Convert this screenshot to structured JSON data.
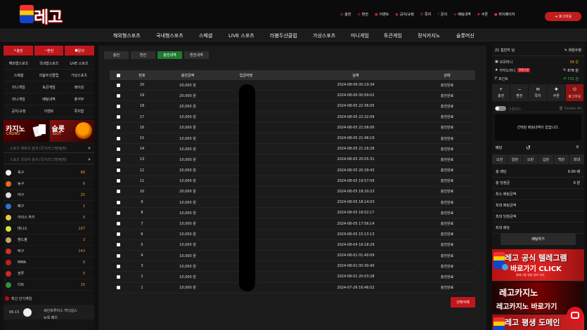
{
  "header": {
    "logo_text": "레고",
    "top_menu": [
      {
        "icon": "plus-icon",
        "label": "충전"
      },
      {
        "icon": "minus-icon",
        "label": "환전"
      },
      {
        "icon": "gift-icon",
        "label": "이벤트"
      },
      {
        "icon": "notice-icon",
        "label": "공지/규정"
      },
      {
        "icon": "mail-icon",
        "label": "쪽지"
      },
      {
        "icon": "question-icon",
        "label": "문의"
      },
      {
        "icon": "list-icon",
        "label": "배팅내역"
      },
      {
        "icon": "point-icon",
        "label": "쿠폰"
      },
      {
        "icon": "user-icon",
        "label": "마이페이지"
      }
    ],
    "logout_label": "로그아웃"
  },
  "nav": [
    "해외형스포츠",
    "국내형스포츠",
    "스페셜",
    "LIVE 스포츠",
    "라붐두샨클럽",
    "가상스포츠",
    "미니게임",
    "토큰게임",
    "정식카지노",
    "슬롯머신"
  ],
  "left": {
    "buttons": [
      "충전",
      "환전",
      "문의"
    ],
    "grid": [
      "해외형스포츠",
      "국내형스포츠",
      "LIVE 스포츠",
      "스페셜",
      "라붐두샨클럽",
      "가상스포츠",
      "미니게임",
      "토큰게임",
      "레이싱",
      "미니게임",
      "배팅내역",
      "출석부",
      "공지/규정",
      "이벤트",
      "쪽지함"
    ],
    "banner1_title": "카지노",
    "banner1_sub": "CASINO",
    "banner2_title": "슬롯",
    "banner2_sub": "SLOT",
    "search1_placeholder": "스포츠 해외식 검색 (국가/리그명/팀명)",
    "search2_placeholder": "스포츠 국내식 검색 (국가/리그명/팀명)",
    "sports": [
      {
        "name": "축구",
        "count": "88",
        "color": "#f2f2f2"
      },
      {
        "name": "농구",
        "count": "6",
        "color": "#e76b1a"
      },
      {
        "name": "야구",
        "count": "25",
        "color": "#dcdcdc"
      },
      {
        "name": "배구",
        "count": "1",
        "color": "#2f6fd6"
      },
      {
        "name": "아이스 하키",
        "count": "0",
        "color": "#e8c547"
      },
      {
        "name": "테니스",
        "count": "107",
        "color": "#d7e23a"
      },
      {
        "name": "핸드볼",
        "count": "3",
        "color": "#c8a56a"
      },
      {
        "name": "탁구",
        "count": "143",
        "color": "#d23030"
      },
      {
        "name": "MMA",
        "count": "0",
        "color": "#c02020"
      },
      {
        "name": "권투",
        "count": "0",
        "color": "#d02828"
      },
      {
        "name": "다트",
        "count": "15",
        "color": "#3a8f3a"
      }
    ],
    "popular_label": "최신 인기게임",
    "match": {
      "time": "06:15",
      "team1": "세인트루이스 카디널스",
      "team2": "뉴욕 메츠"
    }
  },
  "center": {
    "tabs": [
      "충전",
      "환전",
      "충전내역",
      "환전내역"
    ],
    "active_tab": 2,
    "headers": [
      "번호",
      "충전금액",
      "입금자명",
      "날짜",
      "상태"
    ],
    "rows": [
      {
        "no": "20",
        "amount": "20,000 원",
        "date": "2024-08-06 00:19:34",
        "status": "충전완료"
      },
      {
        "no": "19",
        "amount": "20,000 원",
        "date": "2024-08-06 00:09:02",
        "status": "충전완료"
      },
      {
        "no": "18",
        "amount": "20,000 원",
        "date": "2024-08-05 22:36:05",
        "status": "충전완료"
      },
      {
        "no": "17",
        "amount": "10,000 원",
        "date": "2024-08-05 22:32:09",
        "status": "충전완료"
      },
      {
        "no": "16",
        "amount": "10,000 원",
        "date": "2024-08-05 21:58:06",
        "status": "충전완료"
      },
      {
        "no": "15",
        "amount": "10,000 원",
        "date": "2024-08-05 21:46:19",
        "status": "충전완료"
      },
      {
        "no": "14",
        "amount": "10,000 원",
        "date": "2024-08-05 21:16:28",
        "status": "충전완료"
      },
      {
        "no": "13",
        "amount": "10,000 원",
        "date": "2024-08-05 20:55:31",
        "status": "충전완료"
      },
      {
        "no": "12",
        "amount": "20,000 원",
        "date": "2024-08-05 20:39:43",
        "status": "충전완료"
      },
      {
        "no": "11",
        "amount": "10,000 원",
        "date": "2024-08-05 19:57:59",
        "status": "충전완료"
      },
      {
        "no": "10",
        "amount": "20,000 원",
        "date": "2024-08-05 18:20:23",
        "status": "충전완료"
      },
      {
        "no": "9",
        "amount": "10,000 원",
        "date": "2024-08-05 18:14:03",
        "status": "충전완료"
      },
      {
        "no": "8",
        "amount": "10,000 원",
        "date": "2024-08-05 18:02:17",
        "status": "충전완료"
      },
      {
        "no": "7",
        "amount": "10,000 원",
        "date": "2024-08-05 17:56:14",
        "status": "충전완료"
      },
      {
        "no": "6",
        "amount": "10,000 원",
        "date": "2024-08-05 15:13:13",
        "status": "충전완료"
      },
      {
        "no": "5",
        "amount": "10,000 원",
        "date": "2024-08-04 16:18:29",
        "status": "충전완료"
      },
      {
        "no": "4",
        "amount": "10,000 원",
        "date": "2024-08-01 01:40:09",
        "status": "충전완료"
      },
      {
        "no": "3",
        "amount": "10,000 원",
        "date": "2024-08-01 00:30:40",
        "status": "충전완료"
      },
      {
        "no": "2",
        "amount": "10,000 원",
        "date": "2024-08-01 20:03:28",
        "status": "충전완료"
      },
      {
        "no": "1",
        "amount": "10,000 원",
        "date": "2024-07-26 16:46:52",
        "status": "충전완료"
      }
    ],
    "delete_label": "선택삭제"
  },
  "right": {
    "user": "21  힙힌지 님",
    "note": "회원수정",
    "money_label": "보유머니",
    "money_value": "58 원",
    "casino_label": "카지노머니",
    "casino_tag": "전환신청",
    "casino_value": "878 원",
    "point_label": "포인트",
    "point_value": "725 원",
    "quick": [
      {
        "icon": "plus-icon",
        "label": "충전"
      },
      {
        "icon": "minus-icon",
        "label": "환전"
      },
      {
        "icon": "mail-icon",
        "label": "쪽지"
      },
      {
        "icon": "point-icon",
        "label": "쿠폰"
      },
      {
        "icon": "power-icon",
        "label": "로그아웃"
      }
    ],
    "auto_label": "고정모드",
    "delete_all": "Delete All",
    "empty_msg": "선택된 배팅내역이 없습니다.",
    "multi_label": "배당",
    "multi_value": "0",
    "amounts": [
      "오천",
      "일만",
      "오만",
      "십만",
      "백만",
      "최대"
    ],
    "stats": [
      {
        "k": "총 배당",
        "v": "0.00 배"
      },
      {
        "k": "총 당첨금",
        "v": "0 원"
      },
      {
        "k": "최소 배팅금액",
        "v": ""
      },
      {
        "k": "최대 배팅금액",
        "v": ""
      },
      {
        "k": "최대 당첨금액",
        "v": ""
      },
      {
        "k": "최대 배당",
        "v": ""
      }
    ],
    "bet_label": "배팅하기",
    "promo1_line1": "레고 공식 텔레그램",
    "promo1_line2": "바로가기 CLICK",
    "promo1_line3": "텔레그램 채널 정보 보기",
    "promo2_line1": "레고카지노",
    "promo2_line2": "레고카지노 바로가기",
    "promo3_line1": "레고 평생 도메인"
  }
}
